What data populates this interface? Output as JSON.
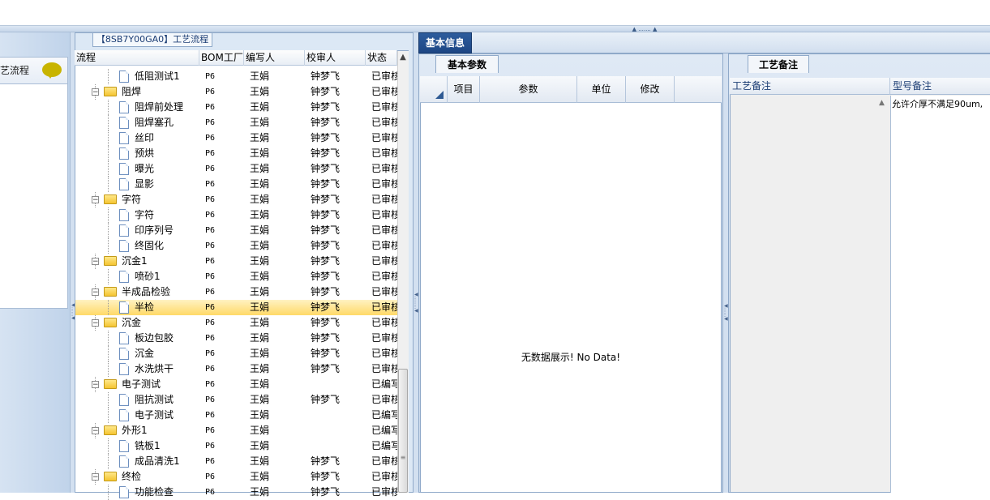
{
  "splitter_grip": "▲ ....... ▲",
  "left_panel": {
    "title": "艺流程"
  },
  "tree_panel": {
    "title": "【8SB7Y00GA0】工艺流程",
    "columns": [
      "流程",
      "BOM工厂",
      "编写人",
      "校审人",
      "状态"
    ],
    "rows": [
      {
        "level": 2,
        "type": "file",
        "name": "低阻测试1",
        "bom": "P6",
        "writer": "王娟",
        "reviewer": "钟梦飞",
        "status": "已审核"
      },
      {
        "level": 1,
        "type": "folder",
        "name": "阻焊",
        "bom": "P6",
        "writer": "王娟",
        "reviewer": "钟梦飞",
        "status": "已审核"
      },
      {
        "level": 2,
        "type": "file",
        "name": "阻焊前处理",
        "bom": "P6",
        "writer": "王娟",
        "reviewer": "钟梦飞",
        "status": "已审核"
      },
      {
        "level": 2,
        "type": "file",
        "name": "阻焊塞孔",
        "bom": "P6",
        "writer": "王娟",
        "reviewer": "钟梦飞",
        "status": "已审核"
      },
      {
        "level": 2,
        "type": "file",
        "name": "丝印",
        "bom": "P6",
        "writer": "王娟",
        "reviewer": "钟梦飞",
        "status": "已审核"
      },
      {
        "level": 2,
        "type": "file",
        "name": "预烘",
        "bom": "P6",
        "writer": "王娟",
        "reviewer": "钟梦飞",
        "status": "已审核"
      },
      {
        "level": 2,
        "type": "file",
        "name": "曝光",
        "bom": "P6",
        "writer": "王娟",
        "reviewer": "钟梦飞",
        "status": "已审核"
      },
      {
        "level": 2,
        "type": "file",
        "name": "显影",
        "bom": "P6",
        "writer": "王娟",
        "reviewer": "钟梦飞",
        "status": "已审核"
      },
      {
        "level": 1,
        "type": "folder",
        "name": "字符",
        "bom": "P6",
        "writer": "王娟",
        "reviewer": "钟梦飞",
        "status": "已审核"
      },
      {
        "level": 2,
        "type": "file",
        "name": "字符",
        "bom": "P6",
        "writer": "王娟",
        "reviewer": "钟梦飞",
        "status": "已审核"
      },
      {
        "level": 2,
        "type": "file",
        "name": "印序列号",
        "bom": "P6",
        "writer": "王娟",
        "reviewer": "钟梦飞",
        "status": "已审核"
      },
      {
        "level": 2,
        "type": "file",
        "name": "终固化",
        "bom": "P6",
        "writer": "王娟",
        "reviewer": "钟梦飞",
        "status": "已审核"
      },
      {
        "level": 1,
        "type": "folder",
        "name": "沉金1",
        "bom": "P6",
        "writer": "王娟",
        "reviewer": "钟梦飞",
        "status": "已审核"
      },
      {
        "level": 2,
        "type": "file",
        "name": "喷砂1",
        "bom": "P6",
        "writer": "王娟",
        "reviewer": "钟梦飞",
        "status": "已审核"
      },
      {
        "level": 1,
        "type": "folder",
        "name": "半成品检验",
        "bom": "P6",
        "writer": "王娟",
        "reviewer": "钟梦飞",
        "status": "已审核"
      },
      {
        "level": 2,
        "type": "file",
        "name": "半检",
        "bom": "P6",
        "writer": "王娟",
        "reviewer": "钟梦飞",
        "status": "已审核",
        "selected": true
      },
      {
        "level": 1,
        "type": "folder",
        "name": "沉金",
        "bom": "P6",
        "writer": "王娟",
        "reviewer": "钟梦飞",
        "status": "已审核"
      },
      {
        "level": 2,
        "type": "file",
        "name": "板边包胶",
        "bom": "P6",
        "writer": "王娟",
        "reviewer": "钟梦飞",
        "status": "已审核"
      },
      {
        "level": 2,
        "type": "file",
        "name": "沉金",
        "bom": "P6",
        "writer": "王娟",
        "reviewer": "钟梦飞",
        "status": "已审核"
      },
      {
        "level": 2,
        "type": "file",
        "name": "水洗烘干",
        "bom": "P6",
        "writer": "王娟",
        "reviewer": "钟梦飞",
        "status": "已审核"
      },
      {
        "level": 1,
        "type": "folder",
        "name": "电子测试",
        "bom": "P6",
        "writer": "王娟",
        "reviewer": "",
        "status": "已编写"
      },
      {
        "level": 2,
        "type": "file",
        "name": "阻抗测试",
        "bom": "P6",
        "writer": "王娟",
        "reviewer": "钟梦飞",
        "status": "已审核"
      },
      {
        "level": 2,
        "type": "file",
        "name": "电子测试",
        "bom": "P6",
        "writer": "王娟",
        "reviewer": "",
        "status": "已编写"
      },
      {
        "level": 1,
        "type": "folder",
        "name": "外形1",
        "bom": "P6",
        "writer": "王娟",
        "reviewer": "",
        "status": "已编写"
      },
      {
        "level": 2,
        "type": "file",
        "name": "铣板1",
        "bom": "P6",
        "writer": "王娟",
        "reviewer": "",
        "status": "已编写"
      },
      {
        "level": 2,
        "type": "file",
        "name": "成品清洗1",
        "bom": "P6",
        "writer": "王娟",
        "reviewer": "钟梦飞",
        "status": "已审核"
      },
      {
        "level": 1,
        "type": "folder",
        "name": "终检",
        "bom": "P6",
        "writer": "王娟",
        "reviewer": "钟梦飞",
        "status": "已审核"
      },
      {
        "level": 2,
        "type": "file",
        "name": "功能检查",
        "bom": "P6",
        "writer": "王娟",
        "reviewer": "钟梦飞",
        "status": "已审核"
      }
    ]
  },
  "basic_info_tab": "基本信息",
  "param_panel": {
    "tab": "基本参数",
    "columns": [
      "项目",
      "参数",
      "单位",
      "修改"
    ],
    "empty_text": "无数据展示! No Data!"
  },
  "note_panel": {
    "tab": "工艺备注",
    "columns": [
      "工艺备注",
      "型号备注"
    ],
    "model_note": "允许介厚不满足90um,"
  },
  "colors": {
    "selected_row": "#ffd968",
    "tab_active": "#1d4684",
    "border": "#8fa9c9"
  }
}
